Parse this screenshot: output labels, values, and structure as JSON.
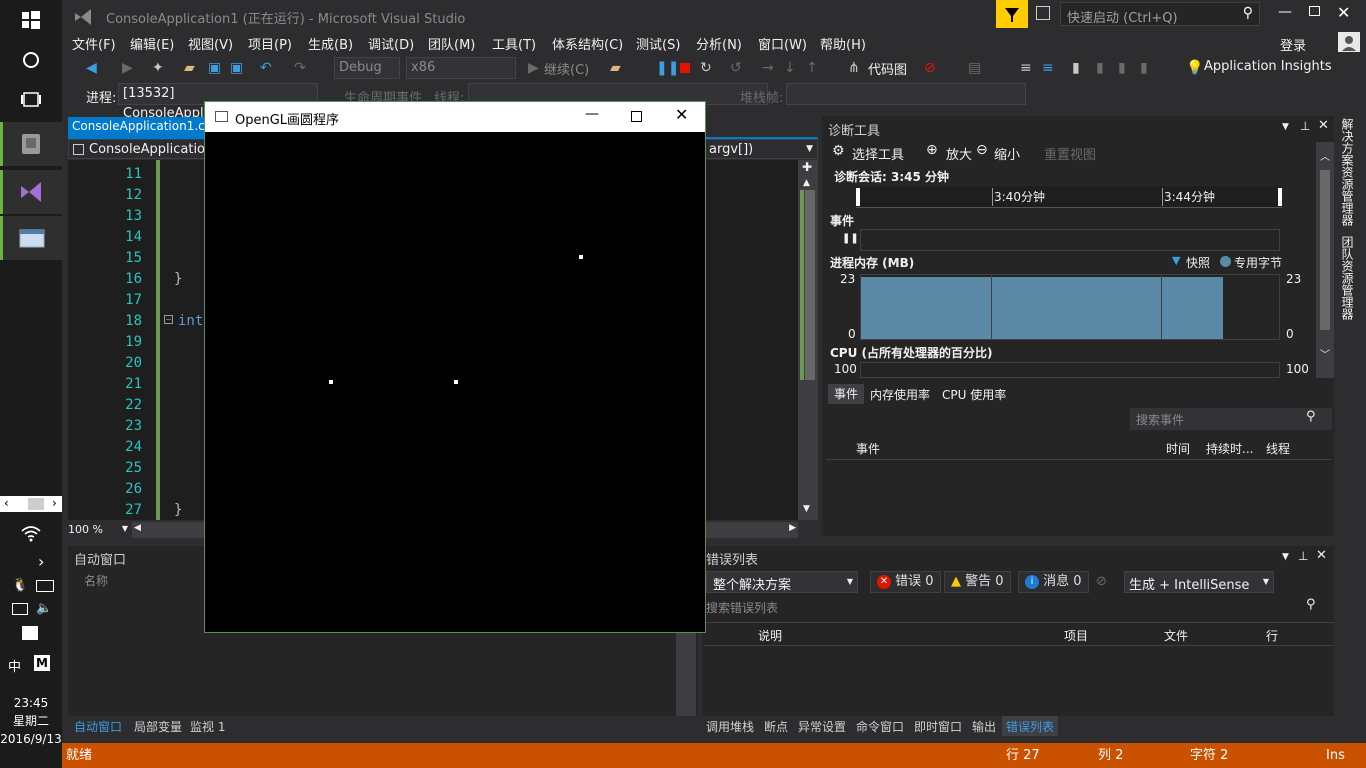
{
  "taskbar": {
    "clock_time": "23:45",
    "clock_day": "星期二",
    "clock_date": "2016/9/13",
    "ime_lang": "中",
    "ime_mode": "M"
  },
  "titlebar": {
    "title": "ConsoleApplication1 (正在运行) - Microsoft Visual Studio",
    "quick_launch_placeholder": "快速启动 (Ctrl+Q)",
    "login": "登录"
  },
  "menu": [
    "文件(F)",
    "编辑(E)",
    "视图(V)",
    "项目(P)",
    "生成(B)",
    "调试(D)",
    "团队(M)",
    "工具(T)",
    "体系结构(C)",
    "测试(S)",
    "分析(N)",
    "窗口(W)",
    "帮助(H)"
  ],
  "toolbar": {
    "config": "Debug",
    "platform": "x86",
    "continue": "继续(C)",
    "codemap": "代码图",
    "app_insights": "Application Insights"
  },
  "toolbar2": {
    "process_label": "进程:",
    "process_value": "[13532] ConsoleApplication1.ex",
    "lifecycle": "生命周期事件",
    "thread_label": "线程:",
    "stack_label": "堆栈帧:"
  },
  "editor": {
    "tab": "ConsoleApplication1.cpp",
    "scope": "ConsoleApplication",
    "member": "argv[])",
    "line_numbers": [
      "11",
      "12",
      "13",
      "14",
      "15",
      "16",
      "17",
      "18",
      "19",
      "20",
      "21",
      "22",
      "23",
      "24",
      "25",
      "26",
      "27"
    ],
    "code_brace1": "}",
    "code_int": "int",
    "code_brace2": "}",
    "zoom": "100 %"
  },
  "opengl_window": {
    "title": "OpenGL画圆程序"
  },
  "diagnostics": {
    "title": "诊断工具",
    "select_tools": "选择工具",
    "zoom_in": "放大",
    "zoom_out": "缩小",
    "reset_view": "重置视图",
    "session": "诊断会话: 3:45 分钟",
    "tick1": "3:40分钟",
    "tick2": "3:44分钟",
    "events_section": "事件",
    "memory_section": "进程内存 (MB)",
    "legend_snapshot": "快照",
    "legend_private": "专用字节",
    "mem_max_left": "23",
    "mem_min_left": "0",
    "mem_max_right": "23",
    "mem_min_right": "0",
    "cpu_section": "CPU (占所有处理器的百分比)",
    "cpu_max_left": "100",
    "cpu_max_right": "100",
    "tabs": [
      "事件",
      "内存使用率",
      "CPU 使用率"
    ],
    "search_placeholder": "搜索事件",
    "cols": [
      "事件",
      "时间",
      "持续时...",
      "线程"
    ],
    "colors": {
      "memory_fill": "#5b8aa6",
      "accent": "#007acc"
    },
    "side_tabs": [
      "解决方案资源管理器",
      "团队资源管理器"
    ]
  },
  "autos": {
    "title": "自动窗口",
    "col_name": "名称",
    "tabs": [
      "自动窗口",
      "局部变量",
      "监视 1"
    ]
  },
  "errors": {
    "title": "错误列表",
    "scope": "整个解决方案",
    "errors": "错误 0",
    "warnings": "警告 0",
    "messages": "消息 0",
    "build_filter": "生成 + IntelliSense",
    "search_placeholder": "搜索错误列表",
    "cols": [
      "说明",
      "项目",
      "文件",
      "行"
    ],
    "tabs": [
      "调用堆栈",
      "断点",
      "异常设置",
      "命令窗口",
      "即时窗口",
      "输出",
      "错误列表"
    ]
  },
  "statusbar": {
    "ready": "就绪",
    "line": "行 27",
    "col": "列 2",
    "char": "字符 2",
    "ins": "Ins",
    "color": "#ca5100"
  }
}
